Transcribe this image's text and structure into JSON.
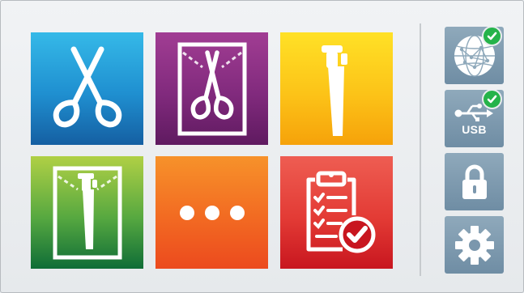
{
  "tiles": [
    {
      "icon": "forceps-icon"
    },
    {
      "icon": "wrapped-forceps-icon"
    },
    {
      "icon": "handpiece-icon"
    },
    {
      "icon": "wrapped-handpiece-icon"
    },
    {
      "icon": "more-dots-icon"
    },
    {
      "icon": "clipboard-check-icon"
    }
  ],
  "side": {
    "network": {
      "icon": "network-globe-icon",
      "status": "connected"
    },
    "usb": {
      "label": "USB",
      "icon": "usb-icon",
      "status": "connected"
    },
    "lock": {
      "icon": "lock-icon"
    },
    "settings": {
      "icon": "gear-icon"
    }
  },
  "colors": {
    "status_ok": "#25b34a",
    "side_button": "#7b97ad"
  }
}
